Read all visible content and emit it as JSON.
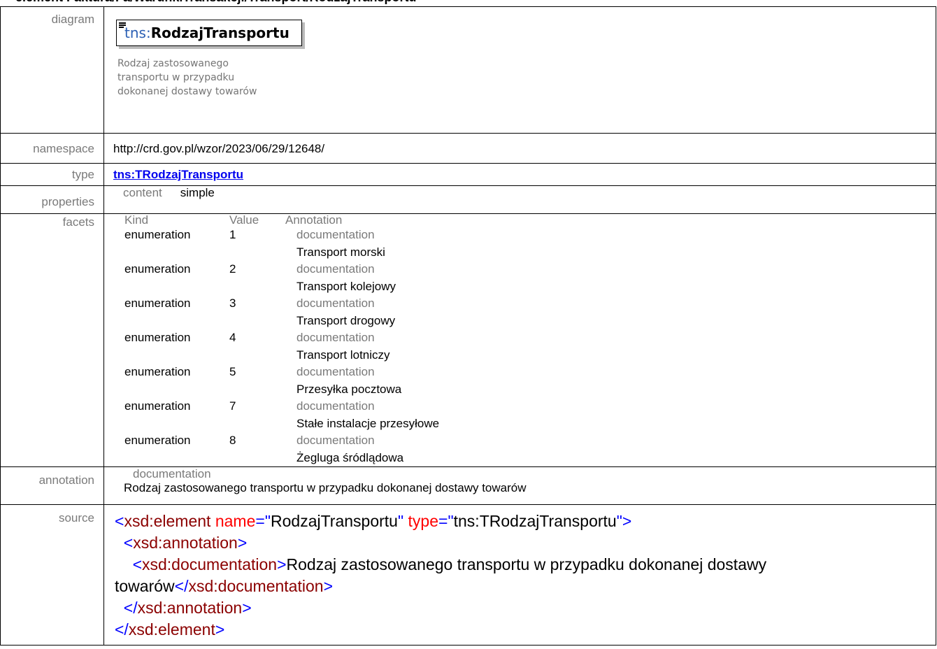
{
  "header": {
    "title": "element Faktura/Fa/WarunkiTransakcji/Transport/RodzajTransportu"
  },
  "labels": {
    "diagram": "diagram",
    "namespace": "namespace",
    "type": "type",
    "properties": "properties",
    "facets": "facets",
    "annotation": "annotation",
    "source": "source"
  },
  "diagram": {
    "prefix": "tns:",
    "name": "RodzajTransportu",
    "doc_lines": [
      "Rodzaj zastosowanego",
      "transportu w przypadku",
      "dokonanej dostawy towarów"
    ]
  },
  "namespace": "http://crd.gov.pl/wzor/2023/06/29/12648/",
  "type": "tns:TRodzajTransportu",
  "properties": {
    "key": "content",
    "value": "simple"
  },
  "facets": {
    "headers": [
      "Kind",
      "Value",
      "Annotation"
    ],
    "rows": [
      {
        "kind": "enumeration",
        "value": "1",
        "ann_label": "documentation",
        "ann_text": "Transport morski"
      },
      {
        "kind": "enumeration",
        "value": "2",
        "ann_label": "documentation",
        "ann_text": "Transport kolejowy"
      },
      {
        "kind": "enumeration",
        "value": "3",
        "ann_label": "documentation",
        "ann_text": "Transport drogowy"
      },
      {
        "kind": "enumeration",
        "value": "4",
        "ann_label": "documentation",
        "ann_text": "Transport lotniczy"
      },
      {
        "kind": "enumeration",
        "value": "5",
        "ann_label": "documentation",
        "ann_text": "Przesyłka pocztowa"
      },
      {
        "kind": "enumeration",
        "value": "7",
        "ann_label": "documentation",
        "ann_text": "Stałe instalacje przesyłowe"
      },
      {
        "kind": "enumeration",
        "value": "8",
        "ann_label": "documentation",
        "ann_text": "Żegluga śródlądowa"
      }
    ]
  },
  "annotation": {
    "label": "documentation",
    "text": "Rodzaj zastosowanego transportu w przypadku dokonanej dostawy towarów"
  },
  "source": {
    "el_open": "xsd:element",
    "attr_name": "name",
    "attr_name_val": "RodzajTransportu",
    "attr_type": "type",
    "attr_type_val": "tns:TRodzajTransportu",
    "ann_tag": "xsd:annotation",
    "doc_tag": "xsd:documentation",
    "doc_text_1": "Rodzaj zastosowanego transportu w przypadku dokonanej dostawy",
    "doc_text_2": "towarów",
    "close_doc": "xsd:documentation",
    "close_ann": "xsd:annotation",
    "close_el": "xsd:element"
  },
  "colors": {
    "markup": "#0000ff",
    "tag": "#8b0000",
    "attr": "#ff0000",
    "label": "#7a7a7a",
    "link": "#0000ee"
  }
}
